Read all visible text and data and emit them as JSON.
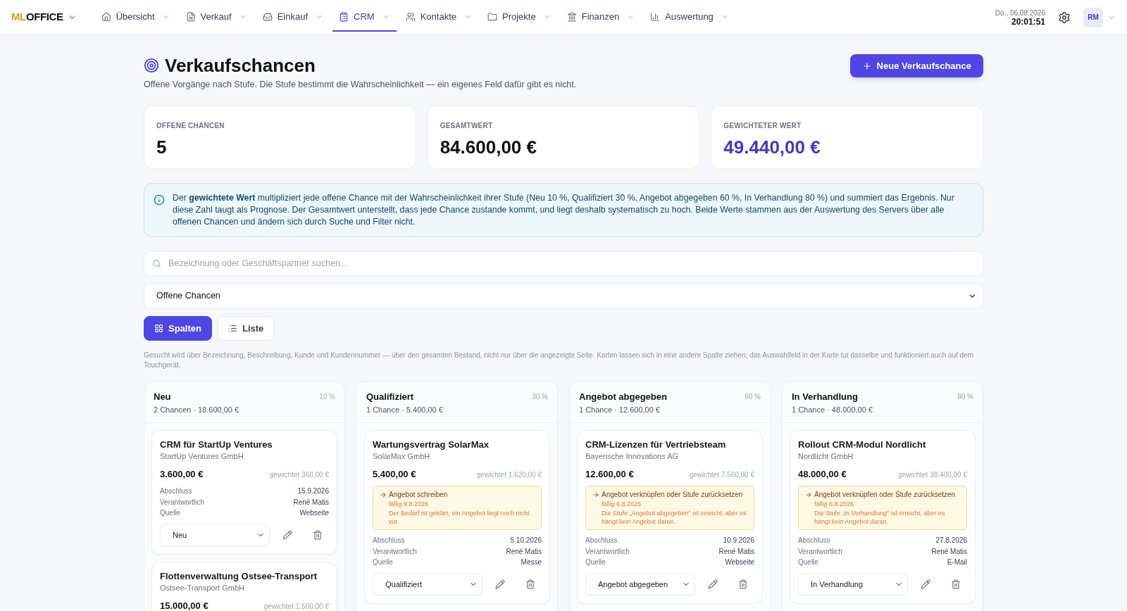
{
  "brand": {
    "prefix": "ML",
    "suffix": "OFFICE"
  },
  "nav": [
    {
      "label": "Übersicht",
      "selected": false
    },
    {
      "label": "Verkauf",
      "selected": false
    },
    {
      "label": "Einkauf",
      "selected": false
    },
    {
      "label": "CRM",
      "selected": true
    },
    {
      "label": "Kontakte",
      "selected": false
    },
    {
      "label": "Projekte",
      "selected": false
    },
    {
      "label": "Finanzen",
      "selected": false
    },
    {
      "label": "Auswertung",
      "selected": false
    }
  ],
  "header": {
    "date": "Do., 06.08.2026",
    "time": "20:01:51",
    "avatar": "RM"
  },
  "page": {
    "title": "Verkaufschancen",
    "subtitle": "Offene Vorgänge nach Stufe. Die Stufe bestimmt die Wahrscheinlichkeit — ein eigenes Feld dafür gibt es nicht.",
    "new_button": "Neue Verkaufschance"
  },
  "stats": [
    {
      "label": "OFFENE CHANCEN",
      "value": "5",
      "highlight": false
    },
    {
      "label": "GESAMTWERT",
      "value": "84.600,00 €",
      "highlight": false
    },
    {
      "label": "GEWICHTETER WERT",
      "value": "49.440,00 €",
      "highlight": true
    }
  ],
  "info": "Der **gewichtete Wert** multipliziert jede offene Chance mit der Wahrscheinlichkeit ihrer Stufe (Neu 10 %, Qualifiziert 30 %, Angebot abgegeben 60 %, In Verhandlung 80 %) und summiert das Ergebnis. Nur diese Zahl taugt als Prognose. Der Gesamtwert unterstellt, dass jede Chance zustande kommt, und liegt deshalb systematisch zu hoch. Beide Werte stammen aus der Auswertung des Servers über alle offenen Chancen und ändern sich durch Suche und Filter nicht.",
  "search": {
    "placeholder": "Bezeichnung oder Geschäftspartner suchen..."
  },
  "filter": {
    "value": "Offene Chancen"
  },
  "views": [
    {
      "label": "Spalten",
      "selected": true
    },
    {
      "label": "Liste",
      "selected": false
    }
  ],
  "hint": "Gesucht wird über Bezeichnung, Beschreibung, Kunde und Kundennummer — über den gesamten Bestand, nicht nur über die angezeigte Seite. Karten lassen sich in eine andere Spalte ziehen; das Auswahlfeld in der Karte tut dasselbe und funktioniert auch auf dem Touchgerät.",
  "columns": [
    {
      "title": "Neu",
      "percent": "10 %",
      "summary": "2 Chancen · 18.600,00 €",
      "cards": [
        {
          "title": "CRM für StartUp Ventures",
          "customer": "StartUp Ventures GmbH",
          "amount": "3.600,00 €",
          "weighted": "gewichtet 360,00 €",
          "details": [
            {
              "label": "Abschluss",
              "value": "15.9.2026"
            },
            {
              "label": "Verantwortlich",
              "value": "René Matis"
            },
            {
              "label": "Quelle",
              "value": "Webseite"
            }
          ],
          "stage": "Neu"
        },
        {
          "title": "Flottenverwaltung Ostsee-Transport",
          "customer": "Ostsee-Transport GmbH",
          "amount": "15.000,00 €",
          "weighted": "gewichtet 1.500,00 €"
        }
      ]
    },
    {
      "title": "Qualifiziert",
      "percent": "30 %",
      "summary": "1 Chance · 5.400,00 €",
      "cards": [
        {
          "title": "Wartungsvertrag SolarMax",
          "customer": "SolarMax GmbH",
          "amount": "5.400,00 €",
          "weighted": "gewichtet 1.620,00 €",
          "task": {
            "title": "Angebot schreiben",
            "due": "fällig 9.8.2026",
            "note": "Der Bedarf ist geklärt, ein Angebot liegt noch nicht vor."
          },
          "details": [
            {
              "label": "Abschluss",
              "value": "5.10.2026"
            },
            {
              "label": "Verantwortlich",
              "value": "René Matis"
            },
            {
              "label": "Quelle",
              "value": "Messe"
            }
          ],
          "stage": "Qualifiziert"
        }
      ]
    },
    {
      "title": "Angebot abgegeben",
      "percent": "60 %",
      "summary": "1 Chance · 12.600,00 €",
      "cards": [
        {
          "title": "CRM-Lizenzen für Vertriebsteam",
          "customer": "Bayerische Innovations AG",
          "amount": "12.600,00 €",
          "weighted": "gewichtet 7.560,00 €",
          "task": {
            "title": "Angebot verknüpfen oder Stufe zurücksetzen",
            "due": "fällig 6.8.2026",
            "note": "Die Stufe „Angebot abgegeben\" ist erreicht, aber es hängt kein Angebot daran."
          },
          "details": [
            {
              "label": "Abschluss",
              "value": "10.9.2026"
            },
            {
              "label": "Verantwortlich",
              "value": "René Matis"
            },
            {
              "label": "Quelle",
              "value": "Webseite"
            }
          ],
          "stage": "Angebot abgegeben"
        }
      ]
    },
    {
      "title": "In Verhandlung",
      "percent": "80 %",
      "summary": "1 Chance · 48.000,00 €",
      "cards": [
        {
          "title": "Rollout CRM-Modul Nordlicht",
          "customer": "Nordlicht GmbH",
          "amount": "48.000,00 €",
          "weighted": "gewichtet 38.400,00 €",
          "task": {
            "title": "Angebot verknüpfen oder Stufe zurücksetzen",
            "due": "fällig 6.8.2026",
            "note": "Die Stufe „In Verhandlung\" ist erreicht, aber es hängt kein Angebot daran."
          },
          "details": [
            {
              "label": "Abschluss",
              "value": "27.8.2026"
            },
            {
              "label": "Verantwortlich",
              "value": "René Matis"
            },
            {
              "label": "Quelle",
              "value": "E-Mail"
            }
          ],
          "stage": "In Verhandlung"
        }
      ]
    }
  ]
}
